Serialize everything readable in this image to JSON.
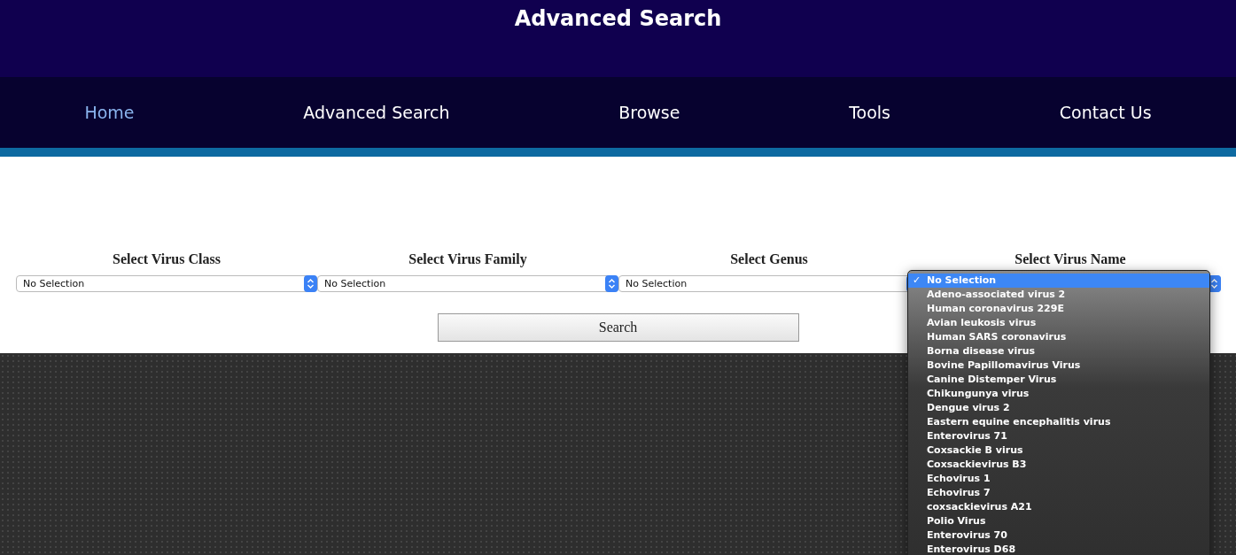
{
  "header": {
    "title": "Advanced Search"
  },
  "nav": [
    {
      "label": "Home",
      "selected": true
    },
    {
      "label": "Advanced Search",
      "selected": false
    },
    {
      "label": "Browse",
      "selected": false
    },
    {
      "label": "Tools",
      "selected": false
    },
    {
      "label": "Contact Us",
      "selected": false
    }
  ],
  "filters": [
    {
      "label": "Select Virus Class",
      "value": "No Selection",
      "open": false
    },
    {
      "label": "Select Virus Family",
      "value": "No Selection",
      "open": false
    },
    {
      "label": "Select Genus",
      "value": "No Selection",
      "open": false
    },
    {
      "label": "Select Virus Name",
      "open": true,
      "options": [
        {
          "label": "No Selection",
          "selected": true
        },
        {
          "label": "Adeno-associated virus 2",
          "selected": false
        },
        {
          "label": "Human coronavirus 229E",
          "selected": false
        },
        {
          "label": "Avian leukosis virus",
          "selected": false
        },
        {
          "label": "Human SARS coronavirus",
          "selected": false
        },
        {
          "label": "Borna disease virus",
          "selected": false
        },
        {
          "label": "Bovine Papillomavirus Virus",
          "selected": false
        },
        {
          "label": "Canine Distemper Virus",
          "selected": false
        },
        {
          "label": "Chikungunya virus",
          "selected": false
        },
        {
          "label": "Dengue virus 2",
          "selected": false
        },
        {
          "label": "Eastern equine encephalitis virus",
          "selected": false
        },
        {
          "label": "Enterovirus 71",
          "selected": false
        },
        {
          "label": "Coxsackie B virus",
          "selected": false
        },
        {
          "label": "Coxsackievirus B3",
          "selected": false
        },
        {
          "label": "Echovirus 1",
          "selected": false
        },
        {
          "label": "Echovirus 7",
          "selected": false
        },
        {
          "label": "coxsackievirus A21",
          "selected": false
        },
        {
          "label": "Polio Virus",
          "selected": false
        },
        {
          "label": "Enterovirus 70",
          "selected": false
        },
        {
          "label": "Enterovirus D68",
          "selected": false
        }
      ]
    }
  ],
  "search_button": "Search",
  "check_mark": "✓"
}
